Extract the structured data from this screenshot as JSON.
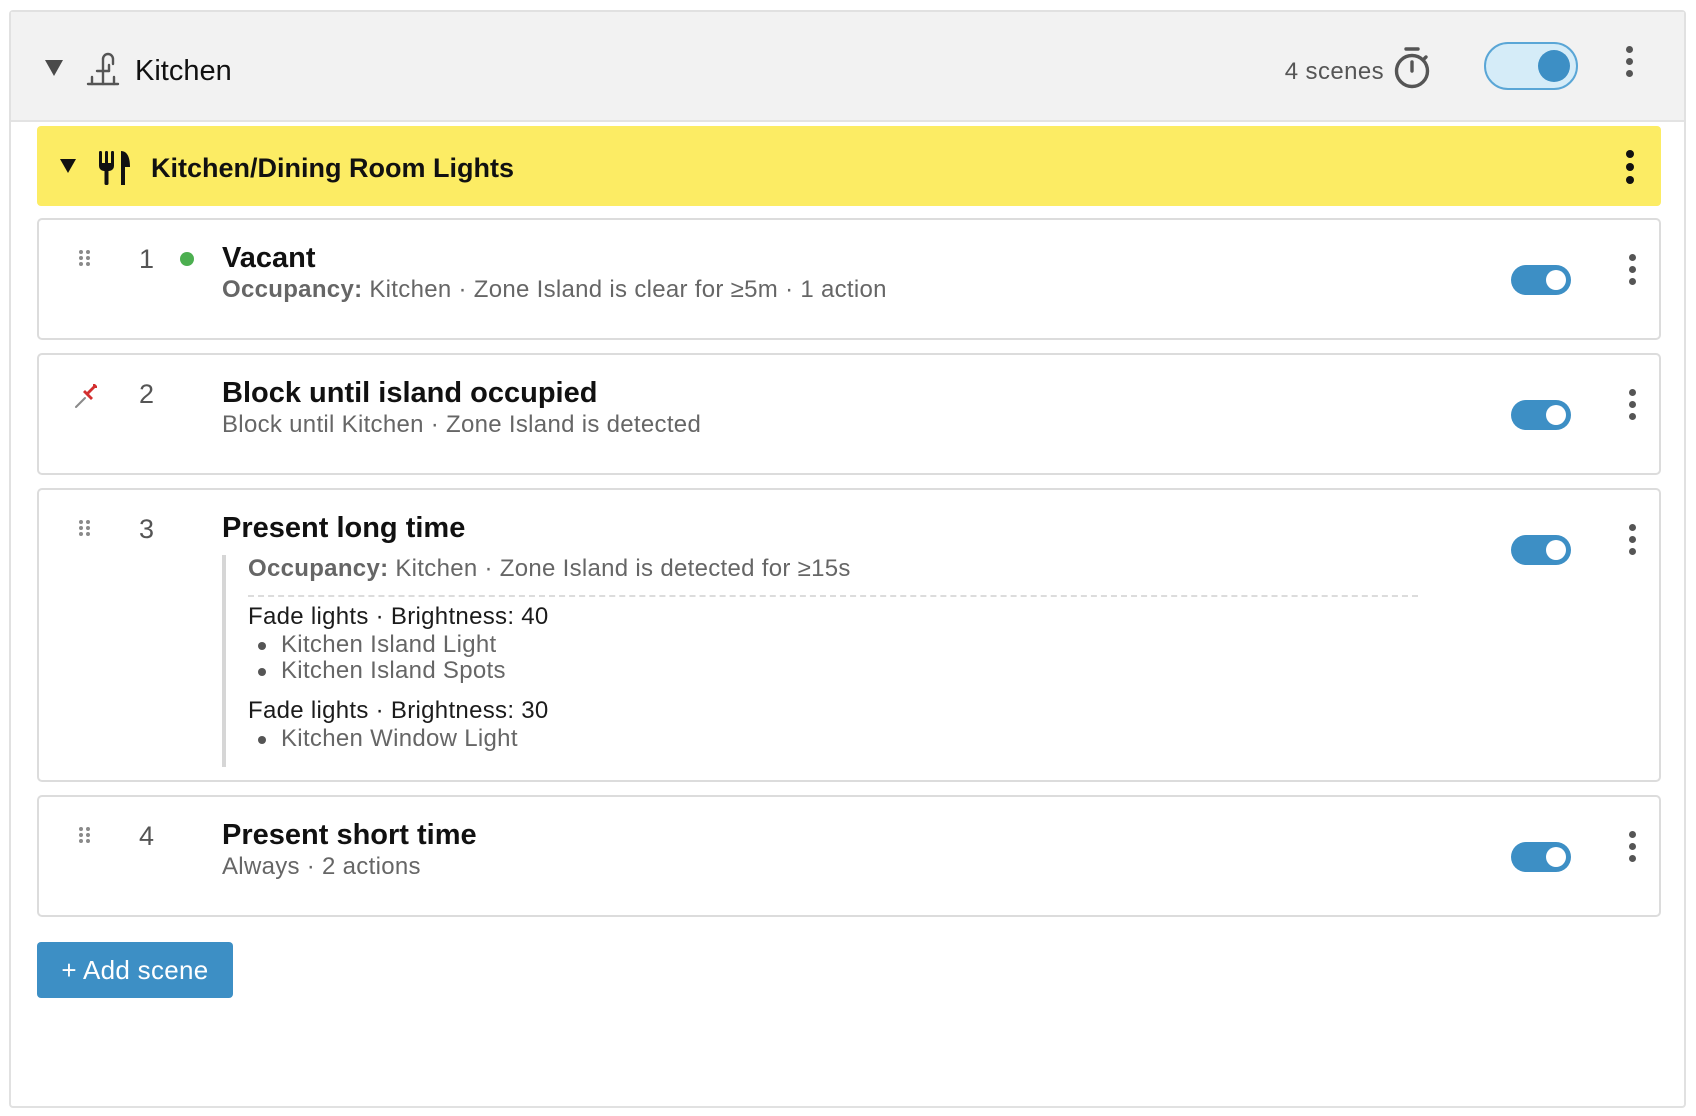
{
  "room": {
    "name": "Kitchen",
    "scene_count": "4 scenes",
    "enabled": true
  },
  "group": {
    "name": "Kitchen/Dining Room Lights",
    "color": "#fcec64"
  },
  "scenes": [
    {
      "index": "1",
      "title": "Vacant",
      "trigger_label": "Occupancy:",
      "subtitle": "Kitchen · Zone Island is clear for ≥5m · 1 action",
      "active": true,
      "enabled": true
    },
    {
      "index": "2",
      "title": "Block until island occupied",
      "subtitle": "Block until Kitchen · Zone Island is detected",
      "pinned": true,
      "enabled": true
    },
    {
      "index": "3",
      "title": "Present long time",
      "trigger_label": "Occupancy:",
      "trigger": "Kitchen · Zone Island is detected for ≥15s",
      "actions": [
        {
          "title": "Fade lights · Brightness: 40",
          "targets": [
            "Kitchen Island Light",
            "Kitchen Island Spots"
          ]
        },
        {
          "title": "Fade lights · Brightness: 30",
          "targets": [
            "Kitchen Window Light"
          ]
        }
      ],
      "enabled": true
    },
    {
      "index": "4",
      "title": "Present short time",
      "subtitle": "Always · 2 actions",
      "enabled": true
    }
  ],
  "add_scene_label": "+ Add scene",
  "icons": {
    "collapse": "caret-down-icon",
    "room": "kitchen-faucet-icon",
    "timer": "stopwatch-icon",
    "group": "fork-knife-icon",
    "drag": "drag-handle-icon",
    "pin": "pushpin-icon",
    "menu": "kebab-menu-icon"
  },
  "colors": {
    "accent": "#3d8fc5",
    "active_dot": "#4caf50"
  }
}
